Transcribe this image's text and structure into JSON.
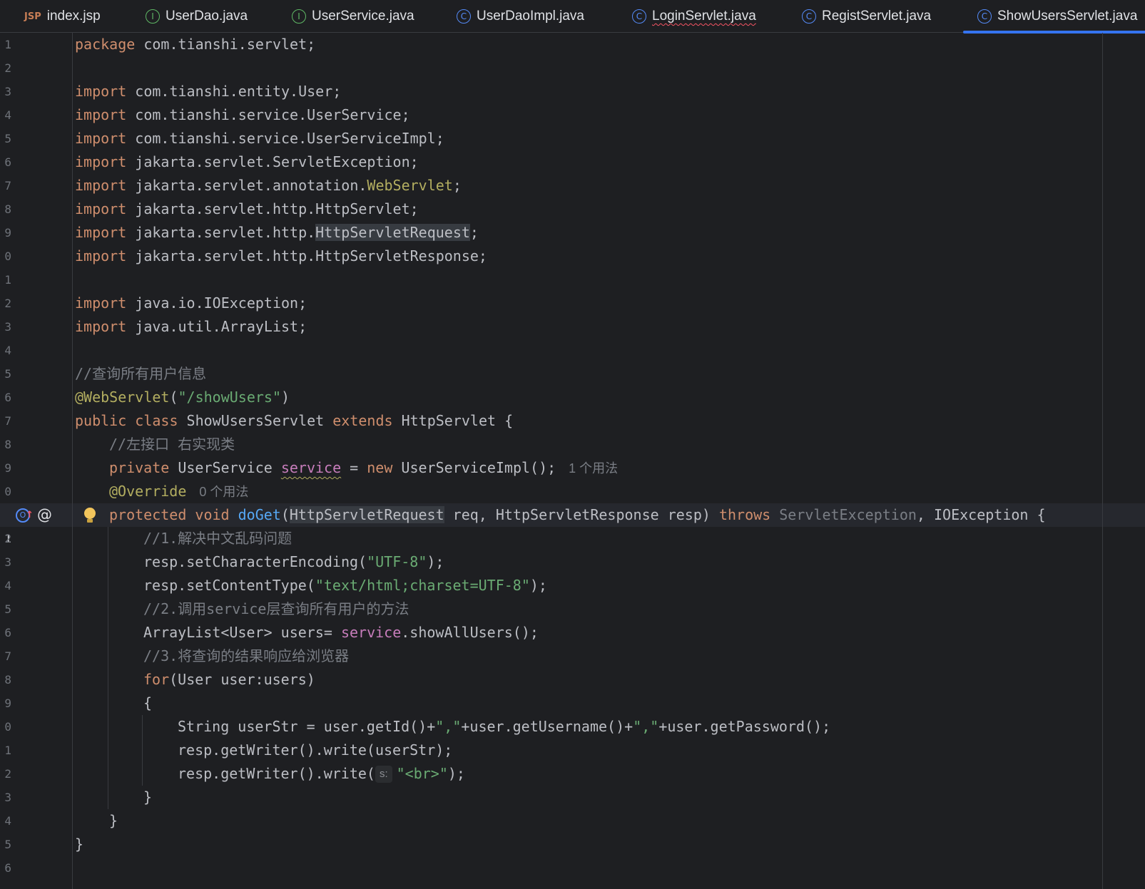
{
  "tabs": [
    {
      "icon": "jsp-file-icon",
      "icon_text": "JSP",
      "label": "index.jsp",
      "error": false,
      "active": false
    },
    {
      "icon": "interface-icon",
      "icon_text": "I",
      "label": "UserDao.java",
      "error": false,
      "active": false
    },
    {
      "icon": "interface-icon",
      "icon_text": "I",
      "label": "UserService.java",
      "error": false,
      "active": false
    },
    {
      "icon": "class-icon",
      "icon_text": "C",
      "label": "UserDaoImpl.java",
      "error": false,
      "active": false
    },
    {
      "icon": "class-icon",
      "icon_text": "C",
      "label": "LoginServlet.java",
      "error": true,
      "active": false
    },
    {
      "icon": "class-icon",
      "icon_text": "C",
      "label": "RegistServlet.java",
      "error": false,
      "active": false
    },
    {
      "icon": "class-icon",
      "icon_text": "C",
      "label": "ShowUsersServlet.java",
      "error": false,
      "active": true
    }
  ],
  "editor": {
    "line_numbers": [
      "1",
      "2",
      "3",
      "4",
      "5",
      "6",
      "7",
      "8",
      "9",
      "0",
      "1",
      "2",
      "3",
      "4",
      "5",
      "6",
      "7",
      "8",
      "9",
      "0",
      "1",
      "2",
      "3",
      "4",
      "5",
      "6",
      "7",
      "8",
      "9",
      "0",
      "1",
      "2",
      "3",
      "4",
      "5",
      "6"
    ],
    "current_line_number": "21",
    "code": {
      "l1": {
        "kw": "package",
        "rest": " com.tianshi.servlet;"
      },
      "l3": {
        "kw": "import",
        "rest": " com.tianshi.entity.User;"
      },
      "l4": {
        "kw": "import",
        "rest": " com.tianshi.service.UserService;"
      },
      "l5": {
        "kw": "import",
        "rest": " com.tianshi.service.UserServiceImpl;"
      },
      "l6": {
        "kw": "import",
        "rest": " jakarta.servlet.ServletException;"
      },
      "l7": {
        "kw": "import",
        "rest": " jakarta.servlet.annotation.",
        "anno": "WebServlet",
        "end": ";"
      },
      "l8": {
        "kw": "import",
        "rest": " jakarta.servlet.http.HttpServlet;"
      },
      "l9": {
        "kw": "import",
        "rest": " jakarta.servlet.http.",
        "hl": "HttpServletRequest",
        "end": ";"
      },
      "l10": {
        "kw": "import",
        "rest": " jakarta.servlet.http.HttpServletResponse;"
      },
      "l12": {
        "kw": "import",
        "rest": " java.io.IOException;"
      },
      "l13": {
        "kw": "import",
        "rest": " java.util.ArrayList;"
      },
      "l15": {
        "comment": "//查询所有用户信息"
      },
      "l16": {
        "anno": "@WebServlet",
        "open": "(",
        "str": "\"/showUsers\"",
        "close": ")"
      },
      "l17": {
        "kw1": "public class",
        "name": " ShowUsersServlet ",
        "kw2": "extends",
        "rest": " HttpServlet {"
      },
      "l18": {
        "comment": "//左接口 右实现类"
      },
      "l19": {
        "kw1": "private",
        "type": " UserService ",
        "field": "service",
        "eq": " = ",
        "kw2": "new",
        "rest": " UserServiceImpl();",
        "hint": "1 个用法"
      },
      "l20": {
        "anno": "@Override",
        "hint": "0 个用法"
      },
      "l21": {
        "kw1": "protected void",
        "sp": " ",
        "fn": "doGet",
        "open": "(",
        "hl": "HttpServletRequest",
        "mid": " req, HttpServletResponse resp) ",
        "kw2": "throws",
        "gray": " ServletException",
        "rest": ", IOException {"
      },
      "l22": {
        "comment": "//1.解决中文乱码问题"
      },
      "l23": {
        "pre": "resp.setCharacterEncoding(",
        "str": "\"UTF-8\"",
        "post": ");"
      },
      "l24": {
        "pre": "resp.setContentType(",
        "str": "\"text/html;charset=UTF-8\"",
        "post": ");"
      },
      "l25": {
        "comment": "//2.调用service层查询所有用户的方法"
      },
      "l26": {
        "pre": "ArrayList<User> users= ",
        "field": "service",
        "post": ".showAllUsers();"
      },
      "l27": {
        "comment": "//3.将查询的结果响应给浏览器"
      },
      "l28": {
        "kw": "for",
        "rest": "(User user:users)"
      },
      "l29": {
        "text": "{"
      },
      "l30": {
        "pre": "String userStr = user.getId()+",
        "s1": "\",\"",
        "mid": "+user.getUsername()+",
        "s2": "\",\"",
        "post": "+user.getPassword();"
      },
      "l31": {
        "text": "resp.getWriter().write(userStr);"
      },
      "l32": {
        "pre": "resp.getWriter().write(",
        "param": "s:",
        "str": "\"<br>\"",
        "post": ");"
      },
      "l33": {
        "text": "}"
      },
      "l34": {
        "text": "}"
      },
      "l35": {
        "text": "}"
      }
    }
  },
  "colors": {
    "background": "#1e1f22",
    "keyword": "#cf8e6d",
    "string": "#6aab73",
    "comment": "#7a7e85",
    "annotation": "#b3ae60",
    "function": "#56a8f5",
    "field": "#c77dbb",
    "active_tab_underline": "#3574f0"
  }
}
